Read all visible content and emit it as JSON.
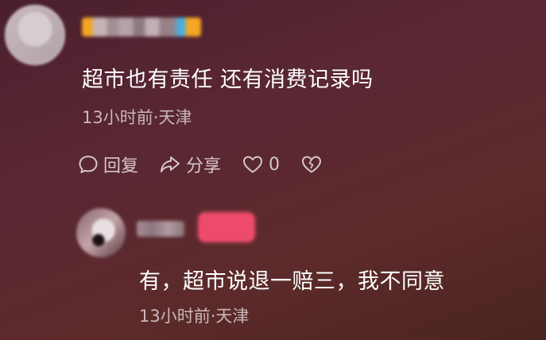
{
  "comments": [
    {
      "text": "超市也有责任 还有消费记录吗",
      "time": "13小时前",
      "location": "天津",
      "meta": "13小时前·天津",
      "actions": {
        "reply_label": "回复",
        "share_label": "分享",
        "like_count": "0"
      }
    }
  ],
  "reply": {
    "text": "有，超市说退一赔三，我不同意",
    "meta": "13小时前·天津"
  },
  "icons": {
    "reply": "chat-bubble-icon",
    "share": "share-arrow-icon",
    "like": "heart-icon",
    "dislike": "broken-heart-icon"
  },
  "colors": {
    "badge": "#ee4a6a",
    "text": "#ffffff",
    "meta": "#c9b7b9"
  }
}
